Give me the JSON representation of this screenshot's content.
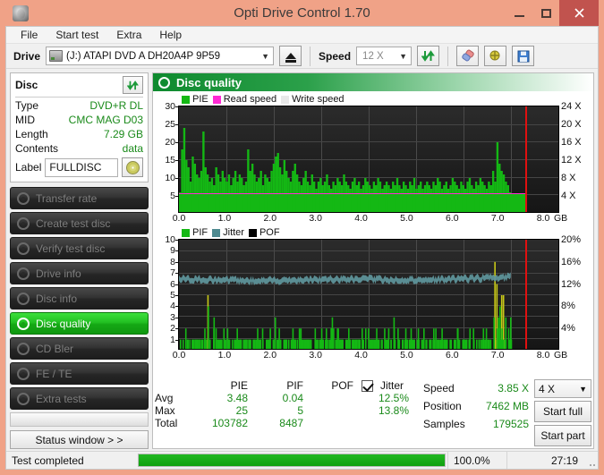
{
  "window": {
    "title": "Opti Drive Control 1.70",
    "app_icon": "disc-icon",
    "minimize": "–",
    "maximize": "□",
    "close": "✕"
  },
  "menu": {
    "items": [
      "File",
      "Start test",
      "Extra",
      "Help"
    ]
  },
  "toolbar": {
    "drive_label": "Drive",
    "drive_value": "(J:)  ATAPI DVD A  DH20A4P 9P59",
    "eject_icon": "eject-icon",
    "speed_label": "Speed",
    "speed_value": "12 X",
    "refresh_icon": "refresh-icon",
    "erase_icon": "eraser-icon",
    "plugin_icon": "plug-icon",
    "save_icon": "save-icon"
  },
  "disc": {
    "heading": "Disc",
    "refresh_icon": "refresh-icon",
    "rows": [
      {
        "key": "Type",
        "value": "DVD+R DL"
      },
      {
        "key": "MID",
        "value": "CMC MAG D03"
      },
      {
        "key": "Length",
        "value": "7.29 GB"
      },
      {
        "key": "Contents",
        "value": "data"
      }
    ],
    "label_key": "Label",
    "label_value": "FULLDISC",
    "label_button_icon": "cd-icon"
  },
  "sidebar": {
    "items": [
      {
        "label": "Transfer rate",
        "icon": "disc-icon",
        "active": false
      },
      {
        "label": "Create test disc",
        "icon": "disc-write-icon",
        "active": false
      },
      {
        "label": "Verify test disc",
        "icon": "disc-check-icon",
        "active": false
      },
      {
        "label": "Drive info",
        "icon": "disc-drive-icon",
        "active": false
      },
      {
        "label": "Disc info",
        "icon": "disc-info-icon",
        "active": false
      },
      {
        "label": "Disc quality",
        "icon": "disc-quality-icon",
        "active": true
      },
      {
        "label": "CD Bler",
        "icon": "disc-icon",
        "active": false
      },
      {
        "label": "FE / TE",
        "icon": "disc-icon",
        "active": false
      },
      {
        "label": "Extra tests",
        "icon": "disc-icon",
        "active": false
      }
    ],
    "status_button": "Status window > >"
  },
  "panel": {
    "heading": "Disc quality",
    "heading_icon": "disc-quality-icon"
  },
  "chart_data": [
    {
      "id": "pie-chart",
      "type": "area",
      "title": "",
      "xlabel": "GB",
      "ylabel": "",
      "xlim": [
        0.0,
        8.0
      ],
      "ylim": [
        0,
        30
      ],
      "y2lim": [
        0,
        24
      ],
      "xticks": [
        "0.0",
        "1.0",
        "2.0",
        "3.0",
        "4.0",
        "5.0",
        "6.0",
        "7.0",
        "8.0"
      ],
      "xunit": "GB",
      "yticks": [
        "30",
        "25",
        "20",
        "15",
        "10",
        "5"
      ],
      "y2ticks": [
        "24 X",
        "20 X",
        "16 X",
        "12 X",
        "8 X",
        "4 X"
      ],
      "grid": true,
      "legend": [
        {
          "name": "PIE",
          "color": "#14b814"
        },
        {
          "name": "Read speed",
          "color": "#ff2ad4"
        },
        {
          "name": "Write speed",
          "color": "#e8e8e8"
        }
      ],
      "data_end_gb": 7.3,
      "marker_line_gb": 7.3,
      "read_speed_level": 5.0,
      "series": [
        {
          "name": "PIE",
          "color": "#14b814",
          "x_step_gb": 0.04,
          "values": [
            6,
            18,
            24,
            15,
            13,
            9,
            16,
            14,
            11,
            10,
            12,
            23,
            13,
            11,
            9,
            10,
            8,
            13,
            11,
            9,
            12,
            10,
            9,
            11,
            8,
            10,
            12,
            9,
            11,
            10,
            8,
            9,
            18,
            12,
            14,
            11,
            9,
            10,
            12,
            8,
            11,
            10,
            9,
            12,
            14,
            16,
            17,
            13,
            11,
            15,
            12,
            10,
            9,
            12,
            14,
            11,
            9,
            8,
            10,
            12,
            9,
            8,
            11,
            9,
            7,
            9,
            10,
            8,
            9,
            11,
            8,
            7,
            9,
            8,
            10,
            9,
            8,
            11,
            9,
            8,
            7,
            9,
            10,
            8,
            9,
            7,
            8,
            10,
            9,
            8,
            7,
            9,
            8,
            10,
            9,
            7,
            8,
            9,
            8,
            7,
            9,
            8,
            10,
            8,
            7,
            9,
            8,
            7,
            9,
            8,
            10,
            7,
            8,
            9,
            7,
            8,
            9,
            8,
            7,
            9,
            8,
            10,
            9,
            7,
            8,
            9,
            7,
            8,
            10,
            9,
            8,
            7,
            9,
            8,
            7,
            9,
            10,
            8,
            7,
            9,
            8,
            10,
            9,
            8,
            7,
            9,
            8,
            12,
            9,
            20,
            14,
            12,
            11,
            9,
            8,
            6
          ]
        }
      ]
    },
    {
      "id": "pif-jitter-chart",
      "type": "bar",
      "title": "",
      "xlabel": "GB",
      "xlim": [
        0.0,
        8.0
      ],
      "ylim": [
        0,
        10
      ],
      "y2lim": [
        0,
        20
      ],
      "xticks": [
        "0.0",
        "1.0",
        "2.0",
        "3.0",
        "4.0",
        "5.0",
        "6.0",
        "7.0",
        "8.0"
      ],
      "xunit": "GB",
      "yticks": [
        "10",
        "9",
        "8",
        "7",
        "6",
        "5",
        "4",
        "3",
        "2",
        "1"
      ],
      "y2ticks": [
        "20%",
        "16%",
        "12%",
        "8%",
        "4%"
      ],
      "grid": true,
      "legend": [
        {
          "name": "PIF",
          "color": "#14b814"
        },
        {
          "name": "Jitter",
          "color": "#4e8a90"
        },
        {
          "name": "POF",
          "color": "#000000"
        }
      ],
      "data_end_gb": 7.3,
      "marker_line_gb": 7.3,
      "series": [
        {
          "name": "Jitter",
          "color": "#5e949a",
          "units": "%",
          "avg": 12.5,
          "max": 13.8,
          "level_y": 6.5
        },
        {
          "name": "PIF",
          "color": "#14b814",
          "peak_values": [
            1,
            2,
            1,
            1,
            2,
            1,
            1,
            5,
            2,
            1,
            1,
            2,
            1,
            1,
            2,
            1,
            1,
            2,
            1,
            1,
            2,
            1,
            1,
            3,
            1,
            2,
            1,
            1,
            2,
            1,
            2,
            1,
            1,
            2,
            1,
            1,
            2,
            3,
            2,
            1,
            2,
            1,
            1,
            2,
            1,
            2,
            1,
            2,
            1,
            1,
            2,
            1,
            3,
            2,
            1,
            2,
            1,
            1,
            2,
            1,
            2,
            1,
            2,
            1,
            2,
            1,
            1,
            2,
            1,
            2,
            1,
            1,
            2,
            1,
            2,
            1,
            2,
            1,
            1,
            2,
            8,
            5,
            3,
            2,
            1
          ]
        }
      ]
    }
  ],
  "stats": {
    "headers": [
      "PIE",
      "PIF",
      "POF",
      "Jitter"
    ],
    "jitter_checked": true,
    "rows": [
      {
        "label": "Avg",
        "pie": "3.48",
        "pif": "0.04",
        "pof": "",
        "jitter": "12.5%"
      },
      {
        "label": "Max",
        "pie": "25",
        "pif": "5",
        "pof": "",
        "jitter": "13.8%"
      },
      {
        "label": "Total",
        "pie": "103782",
        "pif": "8487",
        "pof": "",
        "jitter": ""
      }
    ],
    "speed_label": "Speed",
    "speed_value": "3.85 X",
    "position_label": "Position",
    "position_value": "7462 MB",
    "samples_label": "Samples",
    "samples_value": "179525",
    "test_speed_value": "4 X",
    "start_full": "Start full",
    "start_part": "Start part"
  },
  "statusbar": {
    "message": "Test completed",
    "progress_percent": "100.0%",
    "progress_value": 100,
    "elapsed": "27:19"
  },
  "colors": {
    "accent_green": "#14b814",
    "value_green": "#1a8a1a",
    "titlebar": "#f0a287",
    "close": "#c1534e",
    "read_speed": "#ff2ad4",
    "jitter": "#5e949a",
    "marker": "#e01010"
  }
}
